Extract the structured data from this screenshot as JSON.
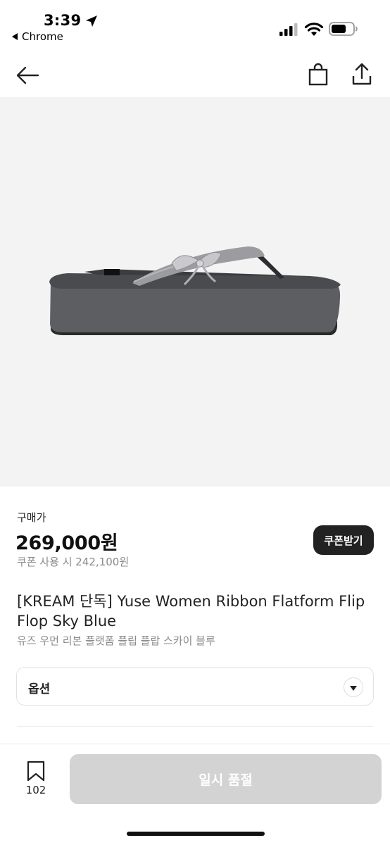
{
  "status_bar": {
    "time": "3:39",
    "back_app": "Chrome",
    "icons": [
      "location-arrow-icon",
      "signal-icon",
      "wifi-icon",
      "battery-icon"
    ]
  },
  "nav": {
    "icons": [
      "back-arrow-icon",
      "shopping-bag-icon",
      "share-icon"
    ]
  },
  "product": {
    "image_icon": "sandal-image",
    "price_label": "구매가",
    "price": "269,000원",
    "coupon_price": "쿠폰 사용 시 242,100원",
    "coupon_button": "쿠폰받기",
    "title": "[KREAM 단독] Yuse Women Ribbon Flatform Flip Flop Sky Blue",
    "subtitle": "유즈 우먼 리본 플랫폼 플립 플랍 스카이 블루"
  },
  "option": {
    "label": "옵션"
  },
  "bottom_bar": {
    "bookmark_count": "102",
    "soldout_label": "일시 품절"
  },
  "colors": {
    "coupon_button_bg": "#222222",
    "soldout_button_bg": "#d3d3d3",
    "image_bg": "#f3f3f3"
  }
}
